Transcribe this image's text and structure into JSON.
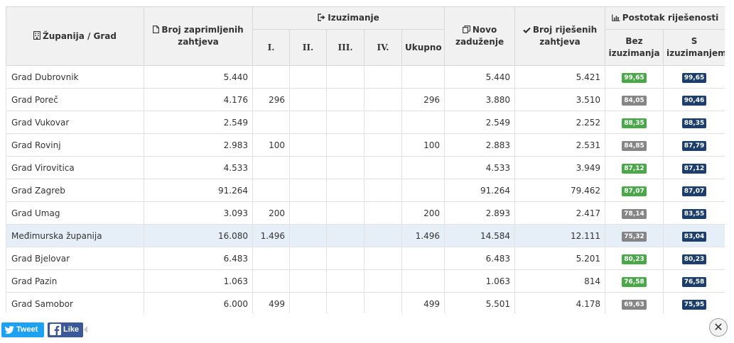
{
  "header": {
    "county_city": "Županija / Grad",
    "received": "Broj zaprimljenih zahtjeva",
    "exemption": "Izuzimanje",
    "roman": [
      "I.",
      "II.",
      "III.",
      "IV."
    ],
    "total": "Ukupno",
    "new_debt": "Novo zaduženje",
    "resolved": "Broj riješenih zahtjeva",
    "percentage": "Postotak riješenosti",
    "without_exemption": "Bez izuzimanja",
    "with_exemption": "S izuzimanjem"
  },
  "colors": {
    "badge_green": "#4aa84a",
    "badge_gray": "#858585",
    "badge_navy": "#1b3e6b",
    "row_highlight": "#e6eef7"
  },
  "rows": [
    {
      "name": "Grad Dubrovnik",
      "received": "5.440",
      "i": "",
      "ii": "",
      "iii": "",
      "iv": "",
      "total": "",
      "new_debt": "5.440",
      "resolved": "5.421",
      "without": "99,65",
      "without_color": "green",
      "with": "99,65"
    },
    {
      "name": "Grad Poreč",
      "received": "4.176",
      "i": "296",
      "ii": "",
      "iii": "",
      "iv": "",
      "total": "296",
      "new_debt": "3.880",
      "resolved": "3.510",
      "without": "84,05",
      "without_color": "gray",
      "with": "90,46"
    },
    {
      "name": "Grad Vukovar",
      "received": "2.549",
      "i": "",
      "ii": "",
      "iii": "",
      "iv": "",
      "total": "",
      "new_debt": "2.549",
      "resolved": "2.252",
      "without": "88,35",
      "without_color": "green",
      "with": "88,35"
    },
    {
      "name": "Grad Rovinj",
      "received": "2.983",
      "i": "100",
      "ii": "",
      "iii": "",
      "iv": "",
      "total": "100",
      "new_debt": "2.883",
      "resolved": "2.531",
      "without": "84,85",
      "without_color": "gray",
      "with": "87,79"
    },
    {
      "name": "Grad Virovitica",
      "received": "4.533",
      "i": "",
      "ii": "",
      "iii": "",
      "iv": "",
      "total": "",
      "new_debt": "4.533",
      "resolved": "3.949",
      "without": "87,12",
      "without_color": "green",
      "with": "87,12"
    },
    {
      "name": "Grad Zagreb",
      "received": "91.264",
      "i": "",
      "ii": "",
      "iii": "",
      "iv": "",
      "total": "",
      "new_debt": "91.264",
      "resolved": "79.462",
      "without": "87,07",
      "without_color": "green",
      "with": "87,07"
    },
    {
      "name": "Grad Umag",
      "received": "3.093",
      "i": "200",
      "ii": "",
      "iii": "",
      "iv": "",
      "total": "200",
      "new_debt": "2.893",
      "resolved": "2.417",
      "without": "78,14",
      "without_color": "gray",
      "with": "83,55"
    },
    {
      "name": "Međimurska županija",
      "received": "16.080",
      "i": "1.496",
      "ii": "",
      "iii": "",
      "iv": "",
      "total": "1.496",
      "new_debt": "14.584",
      "resolved": "12.111",
      "without": "75,32",
      "without_color": "gray",
      "with": "83,04",
      "highlight": true
    },
    {
      "name": "Grad Bjelovar",
      "received": "6.483",
      "i": "",
      "ii": "",
      "iii": "",
      "iv": "",
      "total": "",
      "new_debt": "6.483",
      "resolved": "5.201",
      "without": "80,23",
      "without_color": "green",
      "with": "80,23"
    },
    {
      "name": "Grad Pazin",
      "received": "1.063",
      "i": "",
      "ii": "",
      "iii": "",
      "iv": "",
      "total": "",
      "new_debt": "1.063",
      "resolved": "814",
      "without": "76,58",
      "without_color": "green",
      "with": "76,58"
    },
    {
      "name": "Grad Samobor",
      "received": "6.000",
      "i": "499",
      "ii": "",
      "iii": "",
      "iv": "",
      "total": "499",
      "new_debt": "5.501",
      "resolved": "4.178",
      "without": "69,63",
      "without_color": "gray",
      "with": "75,95"
    }
  ],
  "social": {
    "tweet_label": "Tweet",
    "like_label": "Like",
    "close_symbol": "✕"
  }
}
